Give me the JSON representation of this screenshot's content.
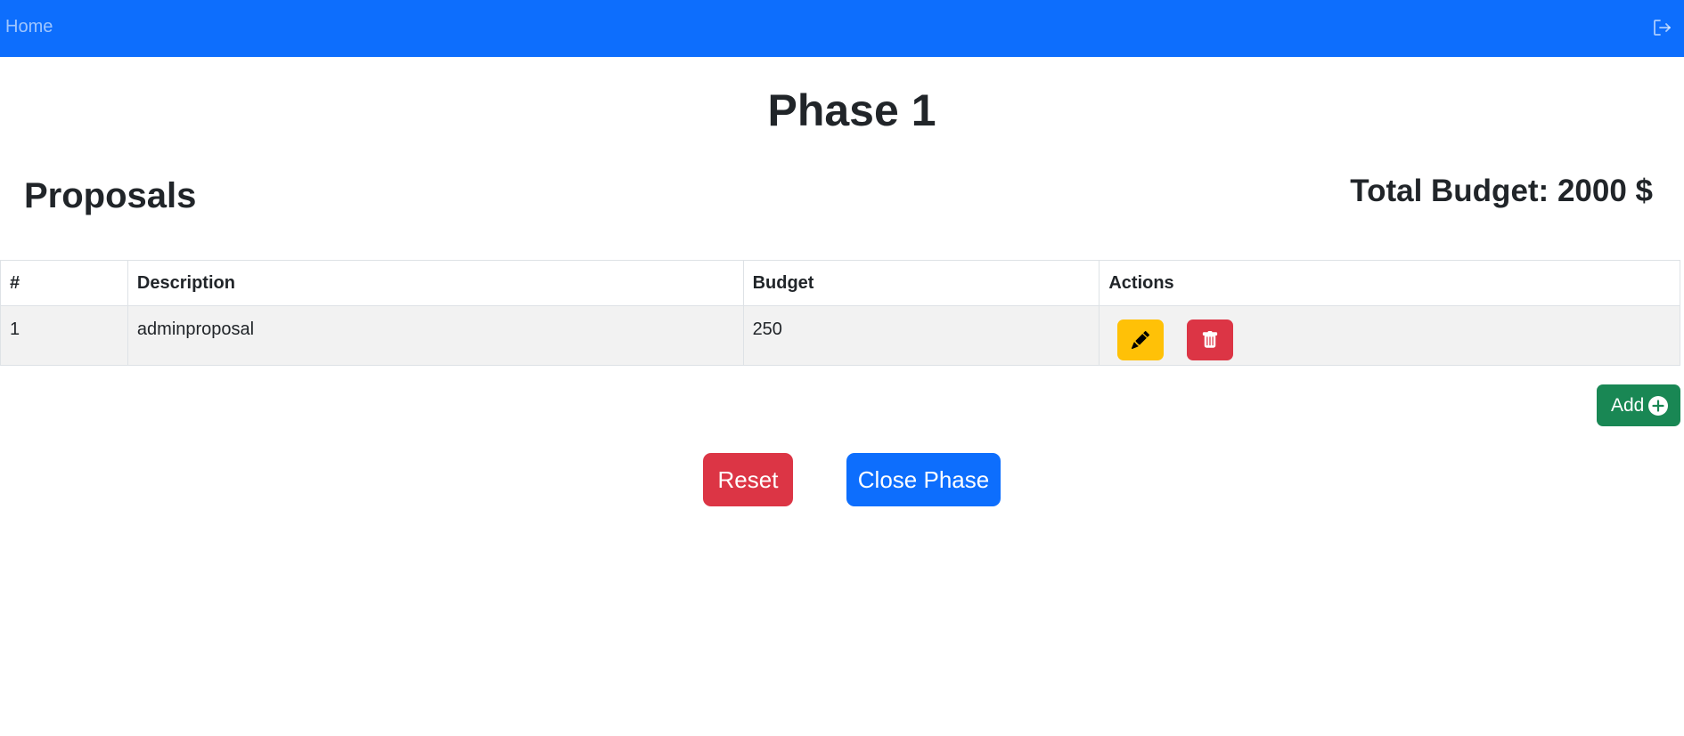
{
  "navbar": {
    "home_label": "Home",
    "logout_icon": "logout-icon"
  },
  "page": {
    "title": "Phase 1",
    "section_title": "Proposals",
    "total_budget": "Total Budget: 2000 $"
  },
  "table": {
    "headers": [
      "#",
      "Description",
      "Budget",
      "Actions"
    ],
    "rows": [
      {
        "id": "1",
        "description": "adminproposal",
        "budget": "250"
      }
    ]
  },
  "buttons": {
    "add_label": "Add",
    "reset_label": "Reset",
    "close_phase_label": "Close Phase"
  },
  "colors": {
    "primary": "#0d6efd",
    "warning": "#ffc107",
    "danger": "#dc3545",
    "success": "#198754"
  }
}
